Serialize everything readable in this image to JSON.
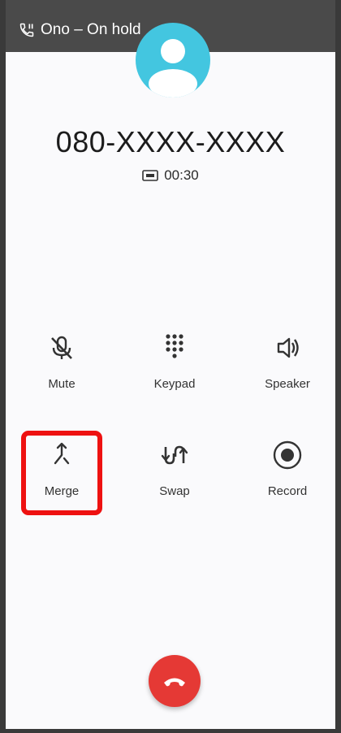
{
  "status_bar": {
    "hold_text": "Ono – On hold"
  },
  "caller": {
    "number": "080-XXXX-XXXX",
    "duration": "00:30"
  },
  "controls": {
    "mute": "Mute",
    "keypad": "Keypad",
    "speaker": "Speaker",
    "merge": "Merge",
    "swap": "Swap",
    "record": "Record"
  },
  "colors": {
    "avatar": "#43c6e0",
    "highlight": "#ee1111",
    "end_call": "#e53935",
    "hold_bar": "#4a4a4a"
  },
  "icons": {
    "hold": "phone-paused-icon",
    "avatar": "person-icon",
    "timer": "hd-call-icon",
    "mute": "mic-off-icon",
    "keypad": "dialpad-icon",
    "speaker": "volume-icon",
    "merge": "merge-icon",
    "swap": "swap-icon",
    "record": "record-icon",
    "end_call": "call-end-icon"
  }
}
